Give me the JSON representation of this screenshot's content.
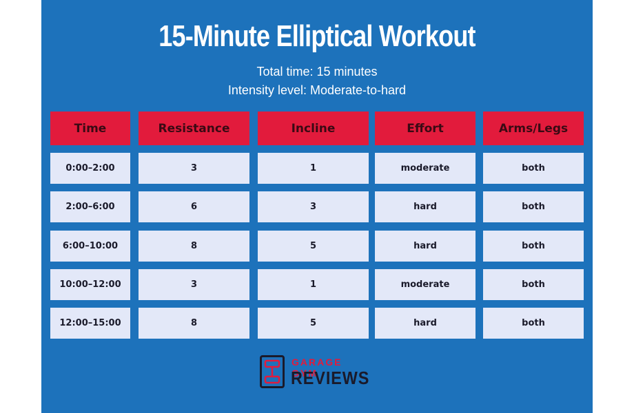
{
  "title": "15-Minute Elliptical Workout",
  "subtitle_time": "Total time: 15 minutes",
  "subtitle_intensity": "Intensity level: Moderate-to-hard",
  "table": {
    "headers": [
      "Time",
      "Resistance",
      "Incline",
      "Effort",
      "Arms/Legs"
    ],
    "rows": [
      [
        "0:00–2:00",
        "3",
        "1",
        "moderate",
        "both"
      ],
      [
        "2:00–6:00",
        "6",
        "3",
        "hard",
        "both"
      ],
      [
        "6:00–10:00",
        "8",
        "5",
        "hard",
        "both"
      ],
      [
        "10:00–12:00",
        "3",
        "1",
        "moderate",
        "both"
      ],
      [
        "12:00–15:00",
        "8",
        "5",
        "hard",
        "both"
      ]
    ]
  },
  "logo": {
    "line1": "GARAGE GYM",
    "line2": "REVIEWS",
    "icon": "dumbbell-icon"
  },
  "colors": {
    "background": "#1d72bb",
    "header": "#e21b3c",
    "cell": "#e3e8f8",
    "text_dark": "#1a1a2a"
  }
}
